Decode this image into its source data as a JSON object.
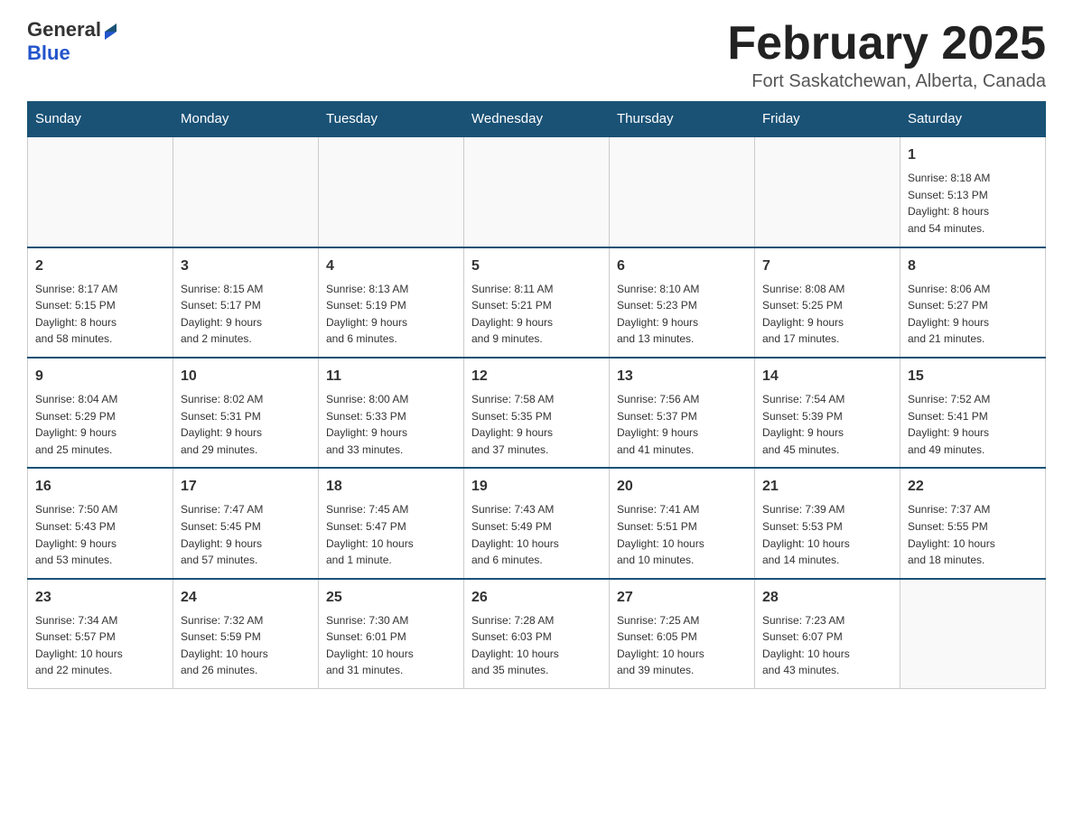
{
  "header": {
    "logo_general": "General",
    "logo_blue": "Blue",
    "month_title": "February 2025",
    "location": "Fort Saskatchewan, Alberta, Canada"
  },
  "weekdays": [
    "Sunday",
    "Monday",
    "Tuesday",
    "Wednesday",
    "Thursday",
    "Friday",
    "Saturday"
  ],
  "weeks": [
    [
      {
        "day": "",
        "info": ""
      },
      {
        "day": "",
        "info": ""
      },
      {
        "day": "",
        "info": ""
      },
      {
        "day": "",
        "info": ""
      },
      {
        "day": "",
        "info": ""
      },
      {
        "day": "",
        "info": ""
      },
      {
        "day": "1",
        "info": "Sunrise: 8:18 AM\nSunset: 5:13 PM\nDaylight: 8 hours\nand 54 minutes."
      }
    ],
    [
      {
        "day": "2",
        "info": "Sunrise: 8:17 AM\nSunset: 5:15 PM\nDaylight: 8 hours\nand 58 minutes."
      },
      {
        "day": "3",
        "info": "Sunrise: 8:15 AM\nSunset: 5:17 PM\nDaylight: 9 hours\nand 2 minutes."
      },
      {
        "day": "4",
        "info": "Sunrise: 8:13 AM\nSunset: 5:19 PM\nDaylight: 9 hours\nand 6 minutes."
      },
      {
        "day": "5",
        "info": "Sunrise: 8:11 AM\nSunset: 5:21 PM\nDaylight: 9 hours\nand 9 minutes."
      },
      {
        "day": "6",
        "info": "Sunrise: 8:10 AM\nSunset: 5:23 PM\nDaylight: 9 hours\nand 13 minutes."
      },
      {
        "day": "7",
        "info": "Sunrise: 8:08 AM\nSunset: 5:25 PM\nDaylight: 9 hours\nand 17 minutes."
      },
      {
        "day": "8",
        "info": "Sunrise: 8:06 AM\nSunset: 5:27 PM\nDaylight: 9 hours\nand 21 minutes."
      }
    ],
    [
      {
        "day": "9",
        "info": "Sunrise: 8:04 AM\nSunset: 5:29 PM\nDaylight: 9 hours\nand 25 minutes."
      },
      {
        "day": "10",
        "info": "Sunrise: 8:02 AM\nSunset: 5:31 PM\nDaylight: 9 hours\nand 29 minutes."
      },
      {
        "day": "11",
        "info": "Sunrise: 8:00 AM\nSunset: 5:33 PM\nDaylight: 9 hours\nand 33 minutes."
      },
      {
        "day": "12",
        "info": "Sunrise: 7:58 AM\nSunset: 5:35 PM\nDaylight: 9 hours\nand 37 minutes."
      },
      {
        "day": "13",
        "info": "Sunrise: 7:56 AM\nSunset: 5:37 PM\nDaylight: 9 hours\nand 41 minutes."
      },
      {
        "day": "14",
        "info": "Sunrise: 7:54 AM\nSunset: 5:39 PM\nDaylight: 9 hours\nand 45 minutes."
      },
      {
        "day": "15",
        "info": "Sunrise: 7:52 AM\nSunset: 5:41 PM\nDaylight: 9 hours\nand 49 minutes."
      }
    ],
    [
      {
        "day": "16",
        "info": "Sunrise: 7:50 AM\nSunset: 5:43 PM\nDaylight: 9 hours\nand 53 minutes."
      },
      {
        "day": "17",
        "info": "Sunrise: 7:47 AM\nSunset: 5:45 PM\nDaylight: 9 hours\nand 57 minutes."
      },
      {
        "day": "18",
        "info": "Sunrise: 7:45 AM\nSunset: 5:47 PM\nDaylight: 10 hours\nand 1 minute."
      },
      {
        "day": "19",
        "info": "Sunrise: 7:43 AM\nSunset: 5:49 PM\nDaylight: 10 hours\nand 6 minutes."
      },
      {
        "day": "20",
        "info": "Sunrise: 7:41 AM\nSunset: 5:51 PM\nDaylight: 10 hours\nand 10 minutes."
      },
      {
        "day": "21",
        "info": "Sunrise: 7:39 AM\nSunset: 5:53 PM\nDaylight: 10 hours\nand 14 minutes."
      },
      {
        "day": "22",
        "info": "Sunrise: 7:37 AM\nSunset: 5:55 PM\nDaylight: 10 hours\nand 18 minutes."
      }
    ],
    [
      {
        "day": "23",
        "info": "Sunrise: 7:34 AM\nSunset: 5:57 PM\nDaylight: 10 hours\nand 22 minutes."
      },
      {
        "day": "24",
        "info": "Sunrise: 7:32 AM\nSunset: 5:59 PM\nDaylight: 10 hours\nand 26 minutes."
      },
      {
        "day": "25",
        "info": "Sunrise: 7:30 AM\nSunset: 6:01 PM\nDaylight: 10 hours\nand 31 minutes."
      },
      {
        "day": "26",
        "info": "Sunrise: 7:28 AM\nSunset: 6:03 PM\nDaylight: 10 hours\nand 35 minutes."
      },
      {
        "day": "27",
        "info": "Sunrise: 7:25 AM\nSunset: 6:05 PM\nDaylight: 10 hours\nand 39 minutes."
      },
      {
        "day": "28",
        "info": "Sunrise: 7:23 AM\nSunset: 6:07 PM\nDaylight: 10 hours\nand 43 minutes."
      },
      {
        "day": "",
        "info": ""
      }
    ]
  ]
}
